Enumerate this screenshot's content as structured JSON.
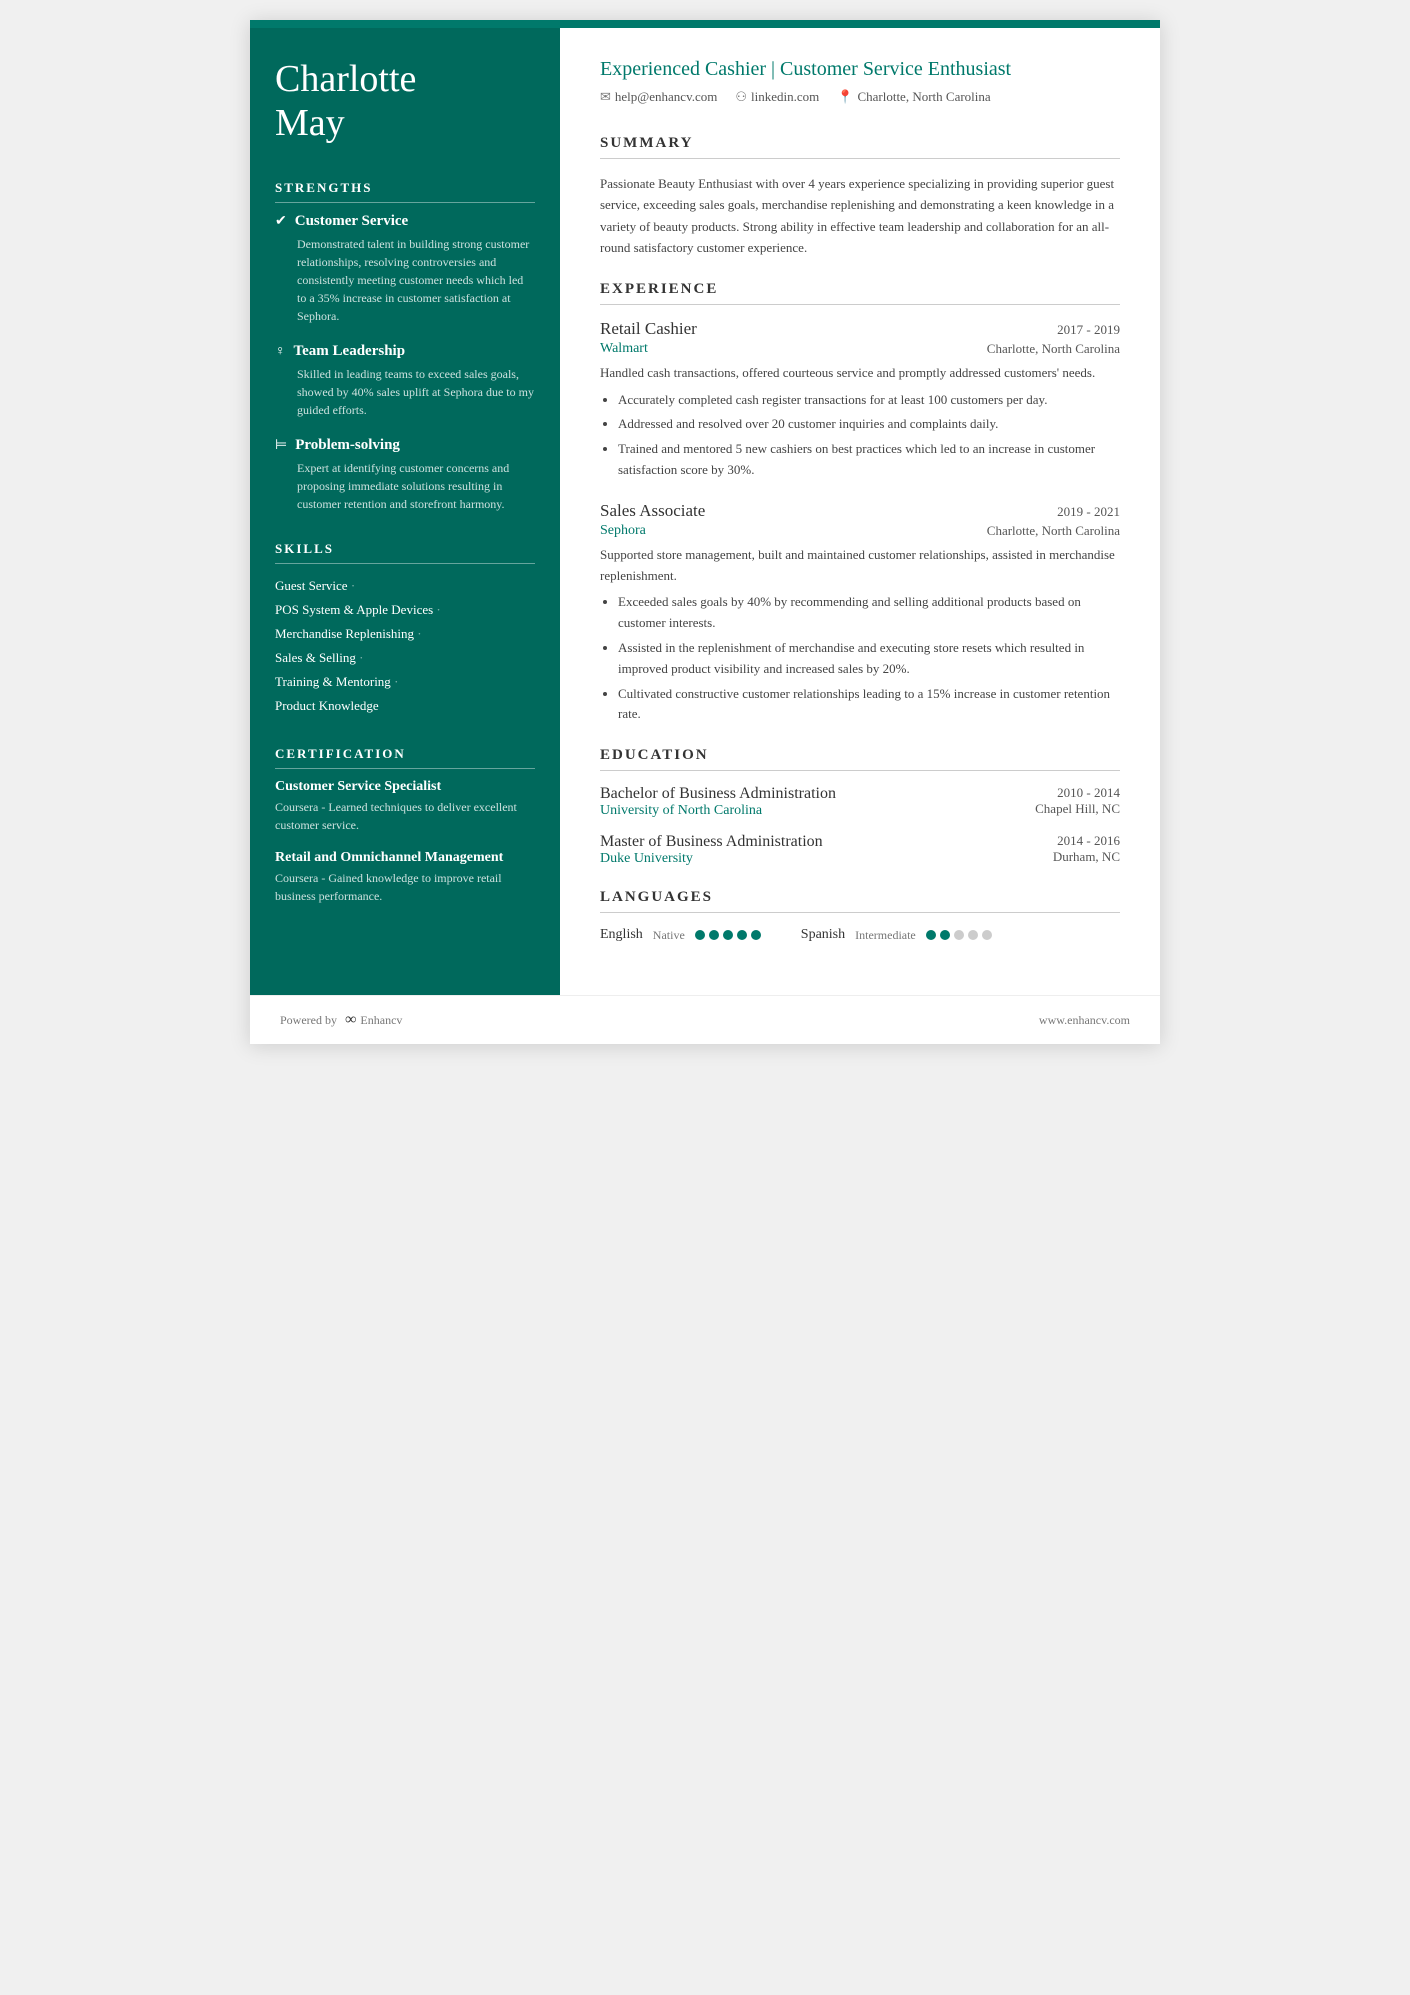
{
  "sidebar": {
    "name_line1": "Charlotte",
    "name_line2": "May",
    "strengths_title": "STRENGTHS",
    "strengths": [
      {
        "icon": "✔",
        "title": "Customer Service",
        "desc": "Demonstrated talent in building strong customer relationships, resolving controversies and consistently meeting customer needs which led to a 35% increase in customer satisfaction at Sephora."
      },
      {
        "icon": "♀",
        "title": "Team Leadership",
        "desc": "Skilled in leading teams to exceed sales goals, showed by 40% sales uplift at Sephora due to my guided efforts."
      },
      {
        "icon": "⊨",
        "title": "Problem-solving",
        "desc": "Expert at identifying customer concerns and proposing immediate solutions resulting in customer retention and storefront harmony."
      }
    ],
    "skills_title": "SKILLS",
    "skills": [
      {
        "label": "Guest Service",
        "has_dot": true
      },
      {
        "label": "POS System & Apple Devices",
        "has_dot": true
      },
      {
        "label": "Merchandise Replenishing",
        "has_dot": true
      },
      {
        "label": "Sales & Selling",
        "has_dot": true
      },
      {
        "label": "Training & Mentoring",
        "has_dot": true
      },
      {
        "label": "Product Knowledge",
        "has_dot": false
      }
    ],
    "certification_title": "CERTIFICATION",
    "certifications": [
      {
        "title": "Customer Service Specialist",
        "desc": "Coursera - Learned techniques to deliver excellent customer service."
      },
      {
        "title": "Retail and Omnichannel Management",
        "desc": "Coursera - Gained knowledge to improve retail business performance."
      }
    ]
  },
  "header": {
    "job_title": "Experienced Cashier | Customer Service Enthusiast",
    "email": "help@enhancv.com",
    "linkedin": "linkedin.com",
    "location": "Charlotte, North Carolina"
  },
  "summary": {
    "title": "SUMMARY",
    "text": "Passionate Beauty Enthusiast with over 4 years experience specializing in providing superior guest service, exceeding sales goals, merchandise replenishing and demonstrating a keen knowledge in a variety of beauty products. Strong ability in effective team leadership and collaboration for an all-round satisfactory customer experience."
  },
  "experience": {
    "title": "EXPERIENCE",
    "entries": [
      {
        "role": "Retail Cashier",
        "dates": "2017 - 2019",
        "company": "Walmart",
        "location": "Charlotte, North Carolina",
        "desc": "Handled cash transactions, offered courteous service and promptly addressed customers' needs.",
        "bullets": [
          "Accurately completed cash register transactions for at least 100 customers per day.",
          "Addressed and resolved over 20 customer inquiries and complaints daily.",
          "Trained and mentored 5 new cashiers on best practices which led to an increase in customer satisfaction score by 30%."
        ]
      },
      {
        "role": "Sales Associate",
        "dates": "2019 - 2021",
        "company": "Sephora",
        "location": "Charlotte, North Carolina",
        "desc": "Supported store management, built and maintained customer relationships, assisted in merchandise replenishment.",
        "bullets": [
          "Exceeded sales goals by 40% by recommending and selling additional products based on customer interests.",
          "Assisted in the replenishment of merchandise and executing store resets which resulted in improved product visibility and increased sales by 20%.",
          "Cultivated constructive customer relationships leading to a 15% increase in customer retention rate."
        ]
      }
    ]
  },
  "education": {
    "title": "EDUCATION",
    "entries": [
      {
        "degree": "Bachelor of Business Administration",
        "school": "University of North Carolina",
        "dates": "2010 - 2014",
        "location": "Chapel Hill, NC"
      },
      {
        "degree": "Master of Business Administration",
        "school": "Duke University",
        "dates": "2014 - 2016",
        "location": "Durham, NC"
      }
    ]
  },
  "languages": {
    "title": "LANGUAGES",
    "entries": [
      {
        "name": "English",
        "level": "Native",
        "filled": 5,
        "total": 5
      },
      {
        "name": "Spanish",
        "level": "Intermediate",
        "filled": 2,
        "total": 5
      }
    ]
  },
  "footer": {
    "powered_by": "Powered by",
    "brand": "Enhancv",
    "website": "www.enhancv.com"
  }
}
